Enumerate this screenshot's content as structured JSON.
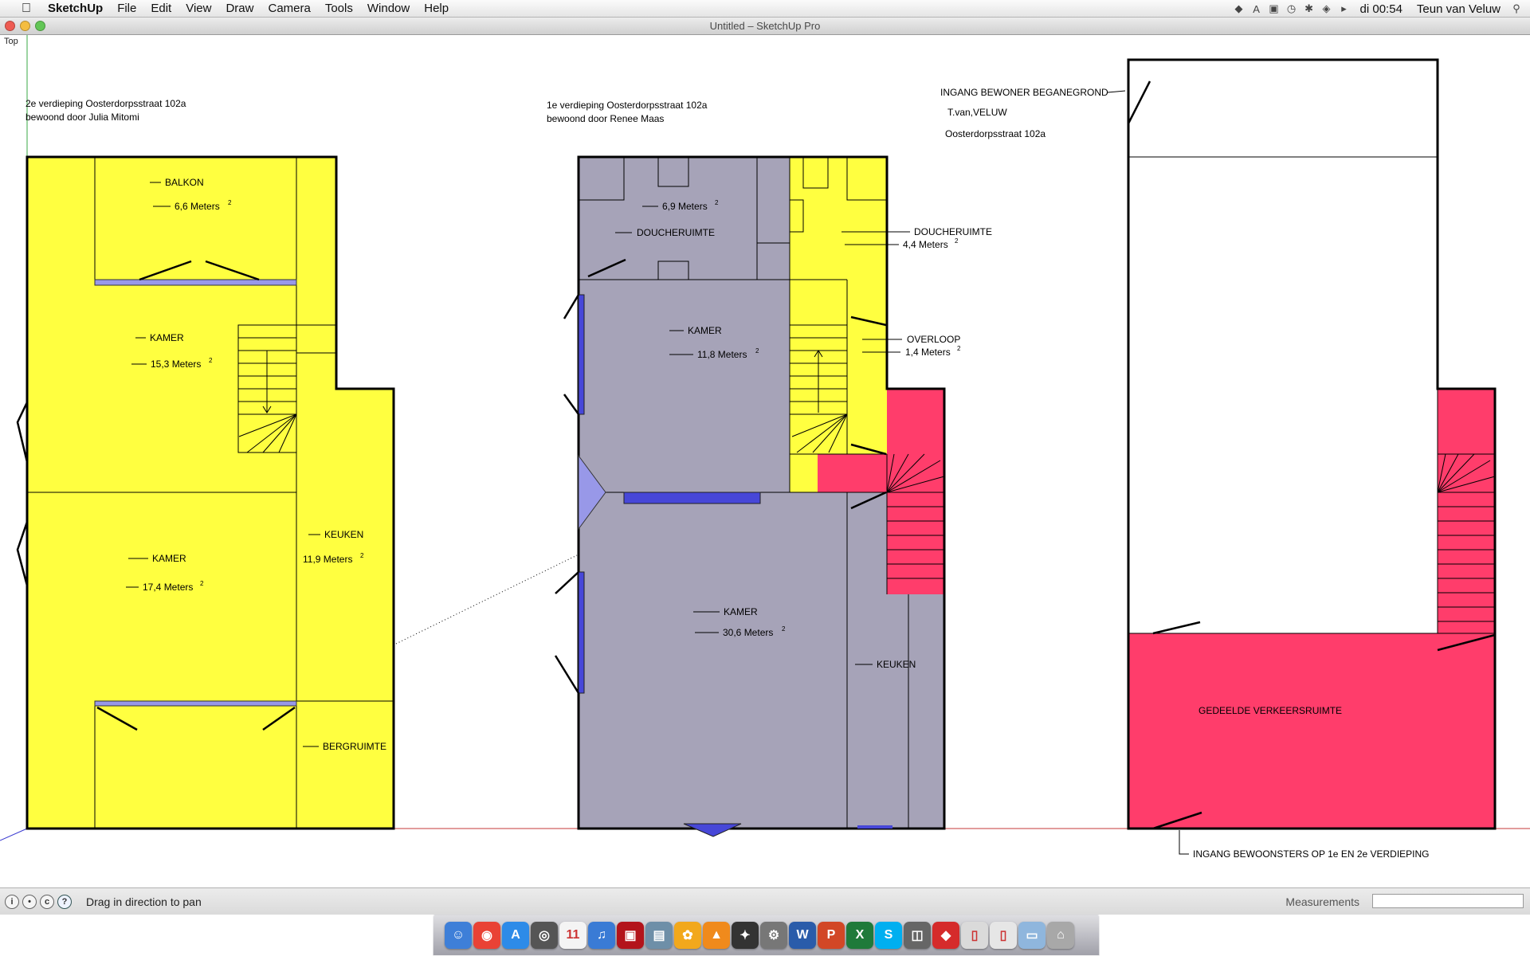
{
  "menubar": {
    "apple_icon": "apple-icon",
    "app_name": "SketchUp",
    "items": [
      "File",
      "Edit",
      "View",
      "Draw",
      "Camera",
      "Tools",
      "Window",
      "Help"
    ],
    "clock": "di 00:54",
    "user": "Teun van Veluw",
    "status_icons": [
      "notification-icon",
      "adobe-icon",
      "display-icon",
      "time-machine-icon",
      "bluetooth-icon",
      "wifi-icon",
      "volume-icon"
    ]
  },
  "window": {
    "title": "Untitled – SketchUp Pro",
    "scene_label": "Top"
  },
  "drawing": {
    "colors": {
      "yellow": "#FFFF40",
      "gray": "#A6A3B8",
      "pink": "#FF3D6B",
      "blue": "#4747D8",
      "light_blue": "#9898E8"
    },
    "plan2": {
      "heading": [
        "2e verdieping Oosterdorpsstraat 102a",
        "bewoond door Julia Mitomi"
      ],
      "rooms": [
        {
          "name": "BALKON",
          "area": "6,6 Meters"
        },
        {
          "name": "KAMER",
          "area": "15,3 Meters"
        },
        {
          "name": "KAMER",
          "area": "17,4 Meters"
        },
        {
          "name": "KEUKEN",
          "area": "11,9 Meters"
        },
        {
          "name": "BERGRUIMTE",
          "area": ""
        }
      ]
    },
    "plan1": {
      "heading": [
        "1e verdieping Oosterdorpsstraat 102a",
        "bewoond door Renee Maas"
      ],
      "rooms": [
        {
          "name": "DOUCHERUIMTE",
          "area": "6,9 Meters"
        },
        {
          "name": "DOUCHERUIMTE",
          "area": "4,4 Meters"
        },
        {
          "name": "KAMER",
          "area": "11,8 Meters"
        },
        {
          "name": "OVERLOOP",
          "area": "1,4 Meters"
        },
        {
          "name": "KAMER",
          "area": "30,6 Meters"
        },
        {
          "name": "KEUKEN",
          "area": ""
        }
      ]
    },
    "plan0": {
      "notes": [
        "INGANG  BEWONER BEGANEGROND",
        "T.van,VELUW",
        "Oosterdorpsstraat 102a"
      ],
      "shared_space": "GEDEELDE VERKEERSRUIMTE",
      "entrance": "INGANG BEWOONSTERS OP 1e EN 2e VERDIEPING"
    },
    "superscript": "2"
  },
  "statusbar": {
    "icons": [
      "user-info-icon",
      "geo-location-icon",
      "credits-icon",
      "help-icon"
    ],
    "hint": "Drag in direction to pan",
    "measurements_label": "Measurements",
    "measurements_value": ""
  },
  "dock": {
    "items": [
      {
        "name": "finder-icon",
        "color": "#3E7FD8",
        "glyph": "☺"
      },
      {
        "name": "chrome-icon",
        "color": "#E94235",
        "glyph": "◉"
      },
      {
        "name": "app-store-icon",
        "color": "#2D8BE8",
        "glyph": "A"
      },
      {
        "name": "facetime-icon",
        "color": "#555555",
        "glyph": "◎"
      },
      {
        "name": "calendar-icon",
        "color": "#F4F4F4",
        "glyph": "11"
      },
      {
        "name": "itunes-icon",
        "color": "#3A7BD5",
        "glyph": "♫"
      },
      {
        "name": "photo-booth-icon",
        "color": "#B3141B",
        "glyph": "▣"
      },
      {
        "name": "iphoto-icon",
        "color": "#6E8FA8",
        "glyph": "▤"
      },
      {
        "name": "picasa-icon",
        "color": "#F2A81C",
        "glyph": "✿"
      },
      {
        "name": "vlc-icon",
        "color": "#F08A1C",
        "glyph": "▲"
      },
      {
        "name": "inkscape-icon",
        "color": "#333333",
        "glyph": "✦"
      },
      {
        "name": "system-preferences-icon",
        "color": "#777777",
        "glyph": "⚙"
      },
      {
        "name": "word-icon",
        "color": "#2A5CAA",
        "glyph": "W"
      },
      {
        "name": "powerpoint-icon",
        "color": "#D24726",
        "glyph": "P"
      },
      {
        "name": "excel-icon",
        "color": "#1F7A3A",
        "glyph": "X"
      },
      {
        "name": "skype-icon",
        "color": "#00AFF0",
        "glyph": "S"
      },
      {
        "name": "image-capture-icon",
        "color": "#666666",
        "glyph": "◫"
      },
      {
        "name": "sketchup-icon",
        "color": "#D52B2B",
        "glyph": "◆"
      },
      {
        "name": "document-icon",
        "color": "#DADADA",
        "glyph": "▯"
      },
      {
        "name": "document-2-icon",
        "color": "#E6E6E6",
        "glyph": "▯"
      },
      {
        "name": "downloads-folder-icon",
        "color": "#8FB6DD",
        "glyph": "▭"
      },
      {
        "name": "trash-icon",
        "color": "#A8A8A8",
        "glyph": "⌂"
      }
    ]
  }
}
